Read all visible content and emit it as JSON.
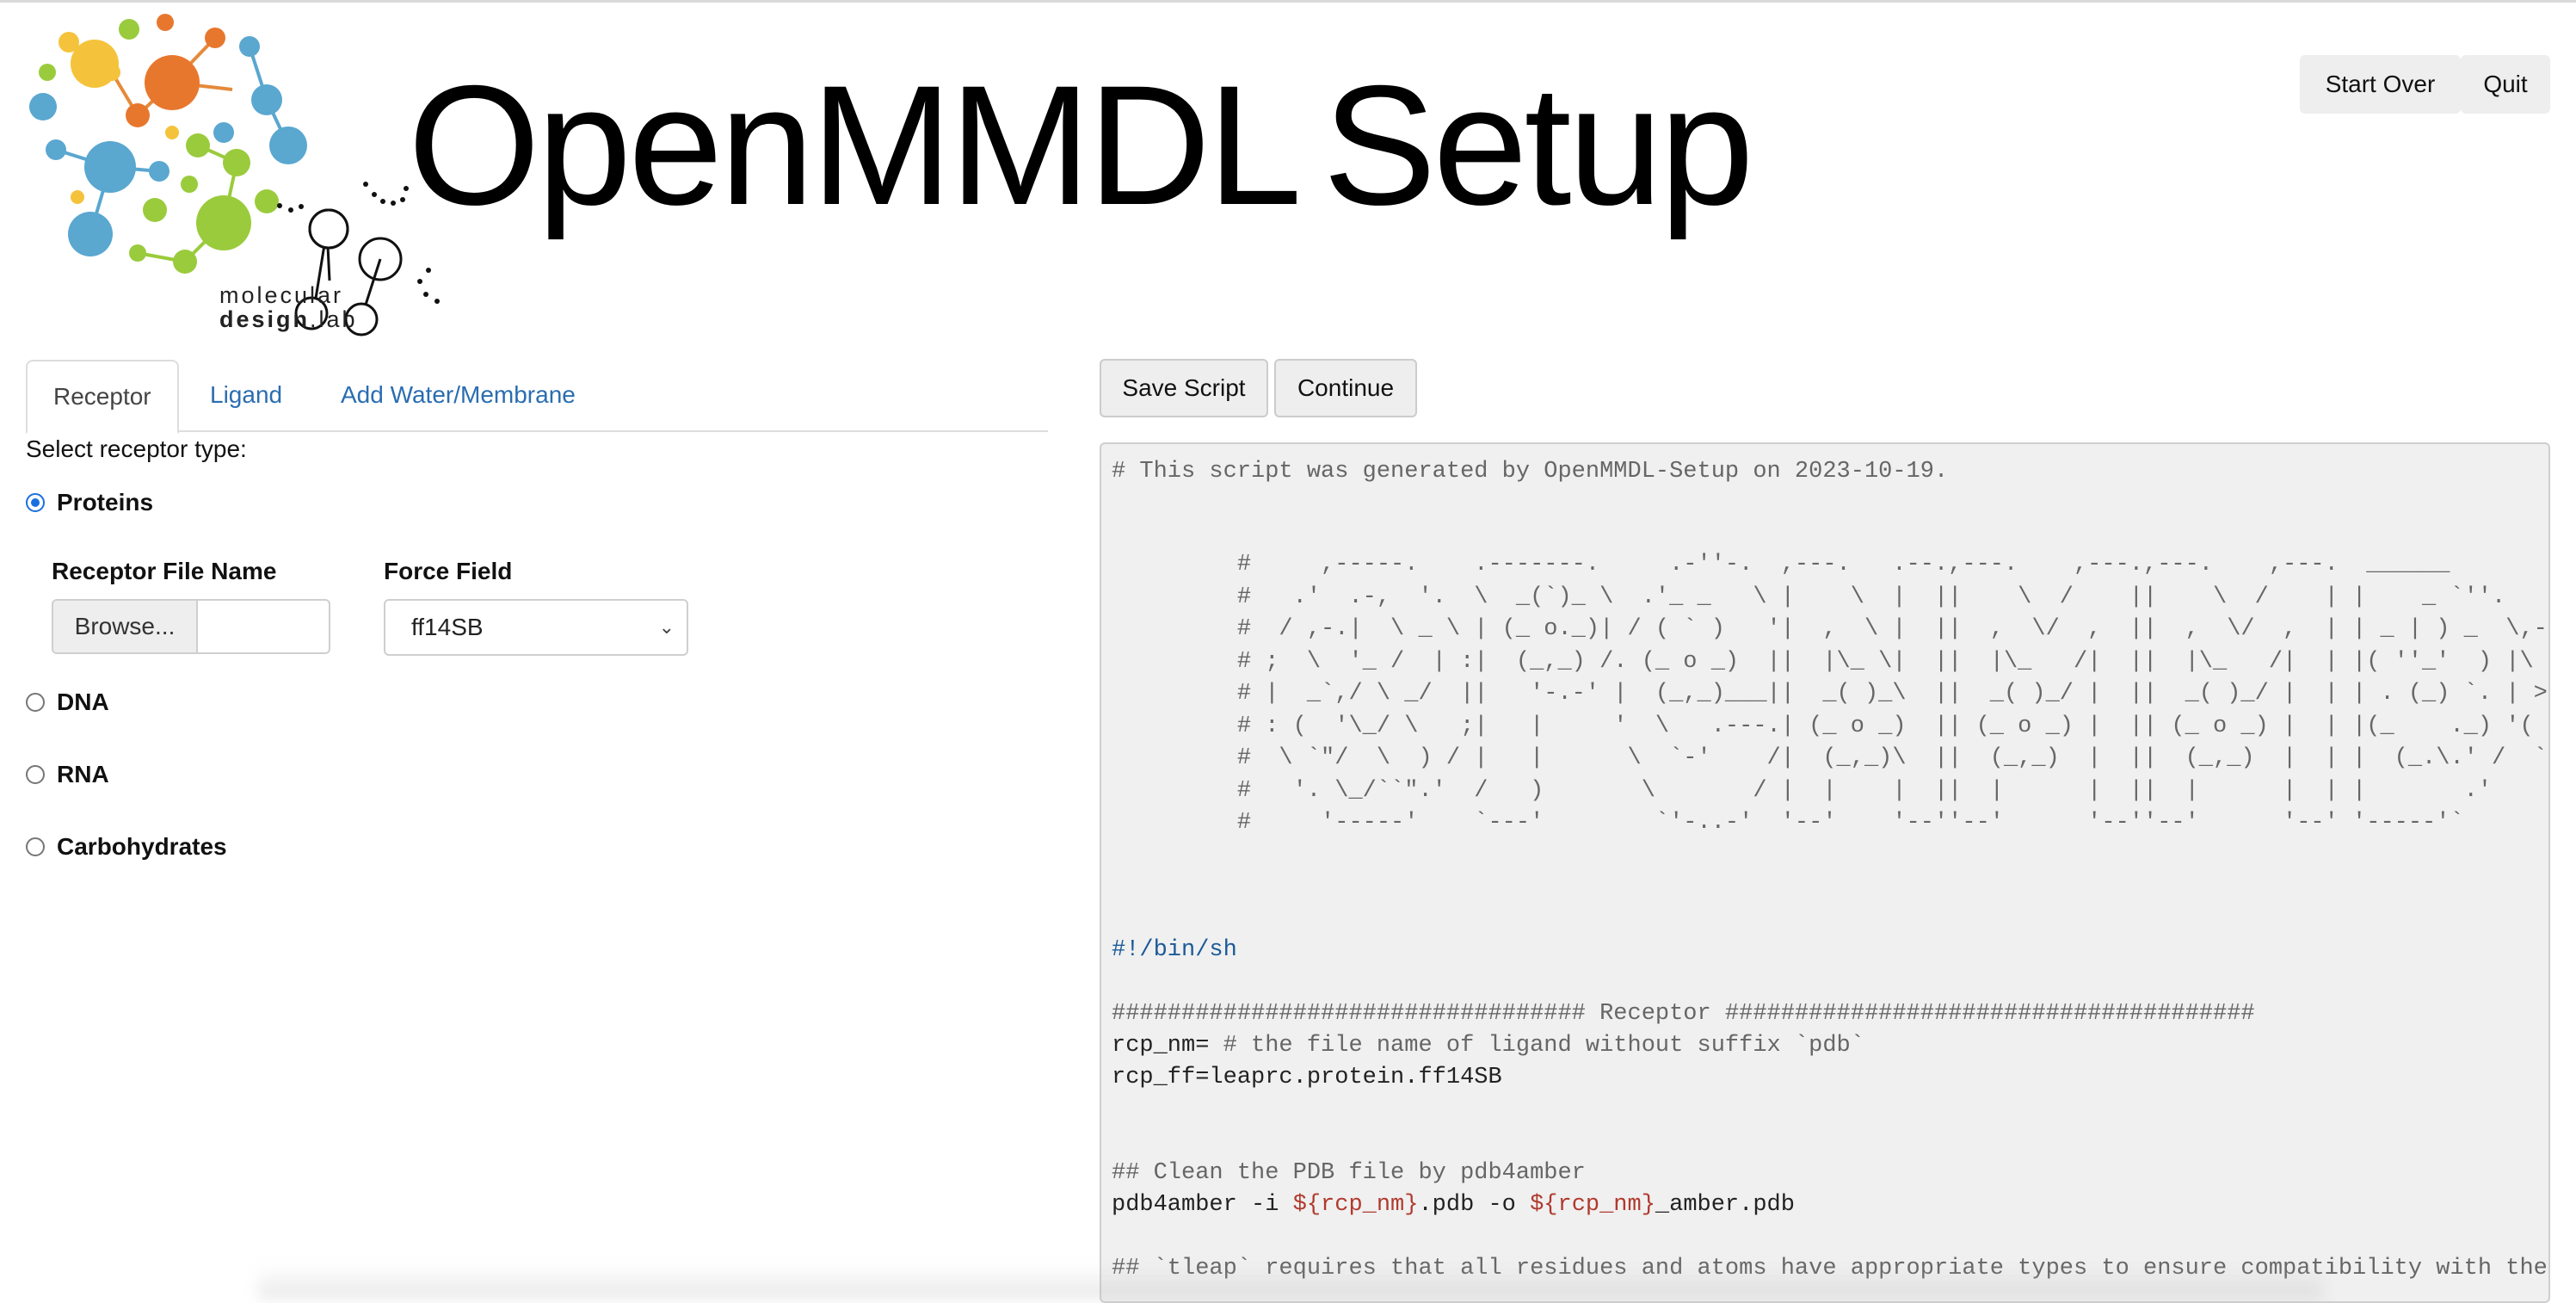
{
  "header": {
    "title_part1": "OpenMMDL",
    "title_part2": "Setup",
    "logo": {
      "line1": "molecular",
      "line2_bold": "design",
      "line2_rest": ".lab"
    },
    "buttons": {
      "start_over": "Start Over",
      "quit": "Quit"
    }
  },
  "tabs": [
    {
      "label": "Receptor",
      "active": true
    },
    {
      "label": "Ligand",
      "active": false
    },
    {
      "label": "Add Water/Membrane",
      "active": false
    }
  ],
  "receptor": {
    "select_label": "Select receptor type:",
    "types": [
      {
        "label": "Proteins",
        "checked": true
      },
      {
        "label": "DNA",
        "checked": false
      },
      {
        "label": "RNA",
        "checked": false
      },
      {
        "label": "Carbohydrates",
        "checked": false
      }
    ],
    "file_label": "Receptor File Name",
    "browse_label": "Browse...",
    "forcefield_label": "Force Field",
    "forcefield_value": "ff14SB"
  },
  "script_toolbar": {
    "save": "Save Script",
    "continue": "Continue"
  },
  "script": {
    "header_comment": "# This script was generated by OpenMMDL-Setup on 2023-10-19.",
    "ascii_banner": [
      "         #     ,-----.    .-------.     .-''-.  ,---.   .--.,---.    ,---.,---.    ,---.  ______       .---.",
      "         #   .'  .-,  '.  \\  _(`)_ \\  .'_ _   \\ |    \\  |  ||    \\  /    ||    \\  /    | |    _ `''.   | ,_|",
      "         #  / ,-.|  \\ _ \\ | (_ o._)| / ( ` )   '|  ,  \\ |  ||  ,  \\/  ,  ||  ,  \\/  ,  | | _ | ) _  \\,-./  )",
      "         # ;  \\  '_ /  | :|  (_,_) /. (_ o _)  ||  |\\_ \\|  ||  |\\_   /|  ||  |\\_   /|  | |( ''_'  ) |\\  '_ '`)",
      "         # |  _`,/ \\ _/  ||   '-.-' |  (_,_)___||  _( )_\\  ||  _( )_/ |  ||  _( )_/ |  | | . (_) `. | > (_)  )",
      "         # : (  '\\_/ \\   ;|   |     '  \\   .---.| (_ o _)  || (_ o _) |  || (_ o _) |  | |(_    ._) '(  .  .-'",
      "         #  \\ `\"/  \\  ) / |   |      \\  `-'    /|  (_,_)\\  ||  (_,_)  |  ||  (_,_)  |  | |  (_.\\.' /  `-'`-'|___",
      "         #   '. \\_/``\".'  /   )       \\       / |  |    |  ||  |      |  ||  |      |  | |       .'    |        \\",
      "         #     '-----'    `---'        `'-..-'  '--'    '--''--'      '--''--'      '--' '-----'`      `--------`"
    ],
    "shebang": "#!/bin/sh",
    "receptor_section": "################################## Receptor ######################################",
    "rcp_nm_line_code": "rcp_nm=",
    "rcp_nm_line_comment": " # the file name of ligand without suffix `pdb`",
    "rcp_ff_line": "rcp_ff=leaprc.protein.ff14SB",
    "clean_comment": "## Clean the PDB file by pdb4amber",
    "pdb4amber_cmd": "pdb4amber -i ",
    "pdb4amber_var1": "${rcp_nm}",
    "pdb4amber_mid": ".pdb -o ",
    "pdb4amber_var2": "${rcp_nm}",
    "pdb4amber_end": "_amber.pdb",
    "tleap_comment": "## `tleap` requires that all residues and atoms have appropriate types to ensure compatibility with the specified force field."
  }
}
